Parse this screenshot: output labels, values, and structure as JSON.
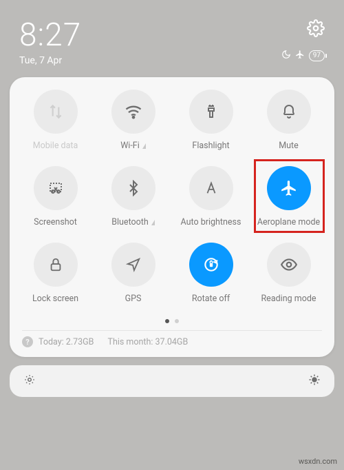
{
  "statusbar": {
    "time": "8:27",
    "date": "Tue, 7 Apr",
    "battery": "97"
  },
  "tiles": {
    "mobile_data": "Mobile data",
    "wifi": "Wi-Fi",
    "flashlight": "Flashlight",
    "mute": "Mute",
    "screenshot": "Screenshot",
    "bluetooth": "Bluetooth",
    "auto_brightness": "Auto brightness",
    "airplane": "Aeroplane mode",
    "lock_screen": "Lock screen",
    "gps": "GPS",
    "rotate": "Rotate off",
    "reading": "Reading mode"
  },
  "usage": {
    "today_label": "Today:",
    "today_value": "2.73GB",
    "month_label": "This month:",
    "month_value": "37.04GB"
  },
  "watermark": "wsxdn.com"
}
